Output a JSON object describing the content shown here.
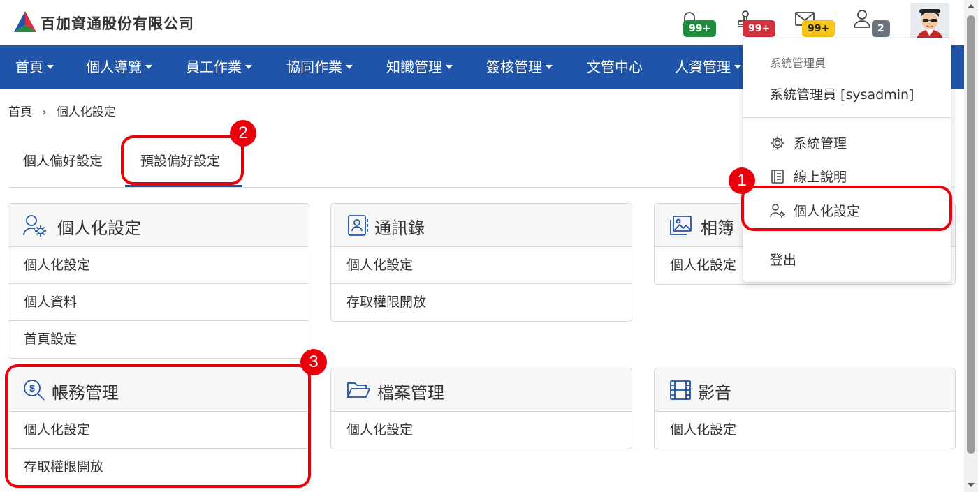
{
  "header": {
    "company_name": "百加資通股份有限公司",
    "badges": {
      "notifications": "99+",
      "approvals": "99+",
      "messages": "99+",
      "users": "2"
    },
    "colors": {
      "green": "#1e8c3c",
      "red": "#d6303f",
      "yellow": "#f5c518",
      "gray": "#6c757d"
    }
  },
  "nav": {
    "items": [
      {
        "label": "首頁",
        "dropdown": true
      },
      {
        "label": "個人導覽",
        "dropdown": true
      },
      {
        "label": "員工作業",
        "dropdown": true
      },
      {
        "label": "協同作業",
        "dropdown": true
      },
      {
        "label": "知識管理",
        "dropdown": true
      },
      {
        "label": "簽核管理",
        "dropdown": true
      },
      {
        "label": "文管中心",
        "dropdown": false
      },
      {
        "label": "人資管理",
        "dropdown": true
      }
    ],
    "color": "#1f54a8"
  },
  "breadcrumb": {
    "home": "首頁",
    "current": "個人化設定"
  },
  "tabs": [
    {
      "label": "個人偏好設定"
    },
    {
      "label": "預設偏好設定",
      "active": true
    }
  ],
  "cards": [
    {
      "title": "個人化設定",
      "icon": "user-gear-icon",
      "rows": [
        "個人化設定",
        "個人資料",
        "首頁設定"
      ]
    },
    {
      "title": "通訊錄",
      "icon": "contact-book-icon",
      "rows": [
        "個人化設定",
        "存取權限開放"
      ]
    },
    {
      "title": "相簿",
      "icon": "image-gallery-icon",
      "rows": [
        "個人化設定"
      ]
    },
    {
      "title": "帳務管理",
      "icon": "dollar-search-icon",
      "rows": [
        "個人化設定",
        "存取權限開放"
      ]
    },
    {
      "title": "檔案管理",
      "icon": "folder-open-icon",
      "rows": [
        "個人化設定"
      ]
    },
    {
      "title": "影音",
      "icon": "film-icon",
      "rows": [
        "個人化設定"
      ]
    }
  ],
  "user_menu": {
    "header": "系統管理員",
    "user": "系統管理員 [sysadmin]",
    "items": [
      {
        "label": "系統管理",
        "icon": "gear-icon"
      },
      {
        "label": "線上說明",
        "icon": "book-icon"
      },
      {
        "label": "個人化設定",
        "icon": "user-gear-icon"
      }
    ],
    "logout": "登出"
  },
  "annotations": {
    "step1": "1",
    "step2": "2",
    "step3": "3",
    "color": "#e8000b"
  }
}
